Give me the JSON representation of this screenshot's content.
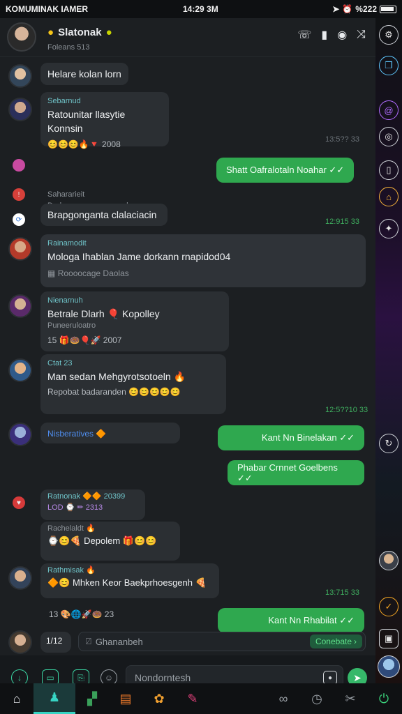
{
  "status": {
    "carrier": "KOMUMINAK IAMER",
    "clock": "14:29 3M",
    "battery_text": "%222"
  },
  "header": {
    "title": "Slatonak",
    "subtitle": "Foleans 513"
  },
  "messages": {
    "m1": {
      "text": "Helare kolan lorn"
    },
    "m2": {
      "sender": "Sebarnud",
      "text": "Ratounitar llasytie Konnsin",
      "reacts": "😊😊😊🔥🔻 2008",
      "time": "13:5?? 33"
    },
    "out1": {
      "text": "Shatt Oafralotaln Noahar ✓✓"
    },
    "m3": {
      "sender": "Sahararieit",
      "sub": "Dadamorenorovennond",
      "text": "Brapgonganta clalaciacin",
      "time": "12:915 33"
    },
    "m4": {
      "sender": "Rainamodit",
      "text": "Mologa Ihablan Jame dorkann rnapidod04",
      "foot": "Roooocage Daolas"
    },
    "m5": {
      "sender": "Nienarnuh",
      "text": "Betrale Dlarh 🎈 Kopolley",
      "sub": "Puneeruloatro",
      "reacts": "15  🎁🍩🎈🚀 2007"
    },
    "m6": {
      "sender": "Ctat 23",
      "text": "Man sedan Mehgyrotsotoeln 🔥",
      "foot": "Repobat badaranden 😊😊😊😊😊",
      "time": "12:5??10 33"
    },
    "m7": {
      "sender": "Nisberatives 🔶"
    },
    "out2": {
      "text": "Kant Nn Binelakan ✓✓"
    },
    "out3": {
      "text": "Phabar Crnnet Goelbens ✓✓"
    },
    "m8": {
      "sender": "Ratnonak 🔶🔶 20399",
      "sub": "LOD ⌚ ✏ 2313",
      "extra_sender": "Rachelaldt 🔥",
      "text": "⌚😊🍕 Depolem 🎁😊😊"
    },
    "m9": {
      "sender": "Rathmisak 🔥",
      "text": "🔶😊 Mhken Keor Baekprhoesgenh 🍕",
      "time": "13:715 33"
    },
    "m10": {
      "reacts": "13  🎨🌐🚀🍩 23"
    },
    "out4": {
      "text": "Kant Nn Rhabilat ✓✓"
    },
    "m11": {
      "text": "1/12"
    }
  },
  "compose": {
    "placeholder": "Ghananbeh",
    "button": "Conebate"
  },
  "input": {
    "placeholder": "Nondorntesh"
  },
  "colors": {
    "accent": "#2fa84f",
    "teal": "#37d4c4"
  }
}
